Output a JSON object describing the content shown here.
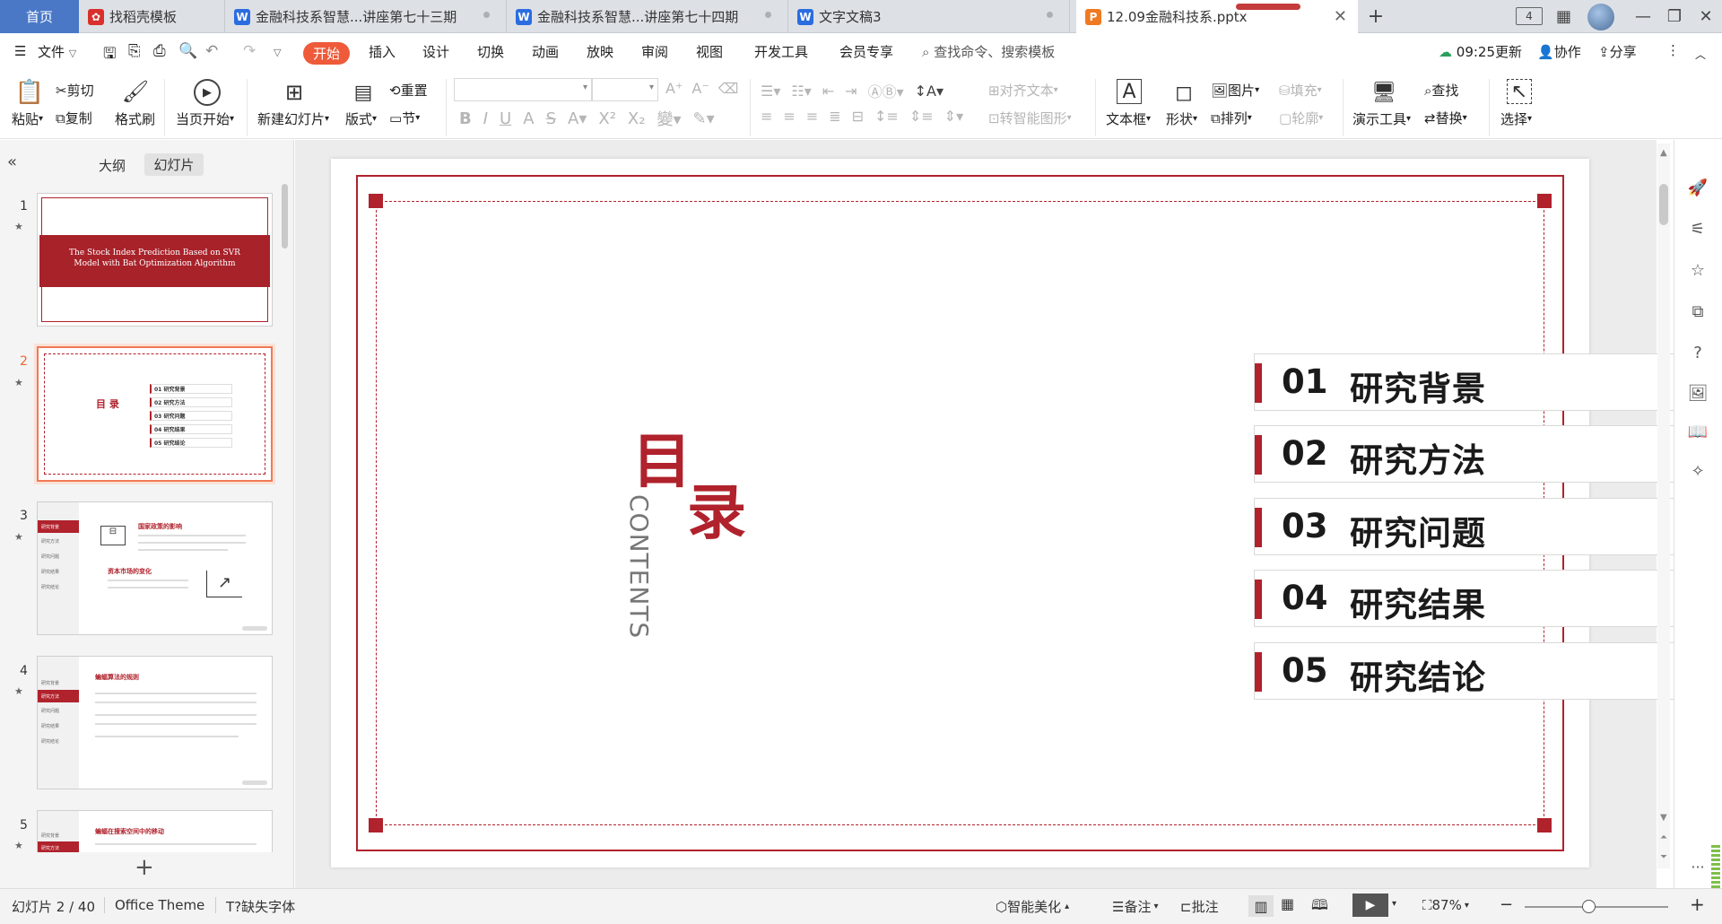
{
  "tabs": {
    "home": "首页",
    "items": [
      {
        "label": "找稻壳模板",
        "icon_color": "#d9302c",
        "icon": "daoke-icon"
      },
      {
        "label": "金融科技系智慧...讲座第七十三期",
        "icon_color": "#2b6de0",
        "icon": "word-icon"
      },
      {
        "label": "金融科技系智慧...讲座第七十四期",
        "icon_color": "#2b6de0",
        "icon": "word-icon"
      },
      {
        "label": "文字文稿3",
        "icon_color": "#2b6de0",
        "icon": "word-icon"
      },
      {
        "label": "12.09金融科技系.pptx",
        "icon_color": "#f07a22",
        "icon": "ppt-icon"
      }
    ],
    "add": "+",
    "badge": "4"
  },
  "menu": {
    "file": "文件",
    "items": [
      "开始",
      "插入",
      "设计",
      "切换",
      "动画",
      "放映",
      "审阅",
      "视图",
      "开发工具",
      "会员专享"
    ],
    "search": "查找命令、搜索模板",
    "update_time": "09:25更新",
    "collab": "协作",
    "share": "分享"
  },
  "ribbon": {
    "paste": "粘贴",
    "cut": "剪切",
    "copy": "复制",
    "format_painter": "格式刷",
    "from_current": "当页开始",
    "new_slide": "新建幻灯片",
    "layout": "版式",
    "reset": "重置",
    "section": "节",
    "align_text": "对齐文本",
    "smart_shape": "转智能图形",
    "textbox": "文本框",
    "shape": "形状",
    "picture": "图片",
    "arrange": "排列",
    "fill": "填充",
    "outline": "轮廓",
    "present_tools": "演示工具",
    "find": "查找",
    "replace": "替换",
    "select": "选择"
  },
  "panel": {
    "tab_outline": "大纲",
    "tab_slides": "幻灯片",
    "add": "+",
    "slides": [
      {
        "num": "1",
        "title": "The Stock Index Prediction Based on SVR Model with Bat Optimization Algorithm"
      },
      {
        "num": "2",
        "title": "目 录",
        "items": [
          "01  研究背景",
          "02  研究方法",
          "03  研究问题",
          "04  研究结果",
          "05  研究结论"
        ]
      },
      {
        "num": "3",
        "title": "国家政策的影响",
        "sub": "资本市场的变化",
        "menu": [
          "研究背景",
          "研究方法",
          "研究问题",
          "研究结果",
          "研究结论"
        ]
      },
      {
        "num": "4",
        "title": "蝙蝠算法的规则",
        "menu": [
          "研究背景",
          "研究方法",
          "研究问题",
          "研究结果",
          "研究结论"
        ]
      },
      {
        "num": "5",
        "title": "蝙蝠在搜索空间中的移动",
        "menu": [
          "研究背景",
          "研究方法"
        ]
      }
    ]
  },
  "slide": {
    "title_chars": [
      "目",
      "录"
    ],
    "subtitle": "CONTENTS",
    "accent_color": "#b0222c",
    "items": [
      {
        "num": "01",
        "text": "研究背景"
      },
      {
        "num": "02",
        "text": "研究方法"
      },
      {
        "num": "03",
        "text": "研究问题"
      },
      {
        "num": "04",
        "text": "研究结果"
      },
      {
        "num": "05",
        "text": "研究结论"
      }
    ]
  },
  "status": {
    "slide_count": "幻灯片 2 / 40",
    "theme": "Office Theme",
    "missing_font": "缺失字体",
    "beautify": "智能美化",
    "notes": "备注",
    "comments": "批注",
    "zoom": "87%"
  }
}
